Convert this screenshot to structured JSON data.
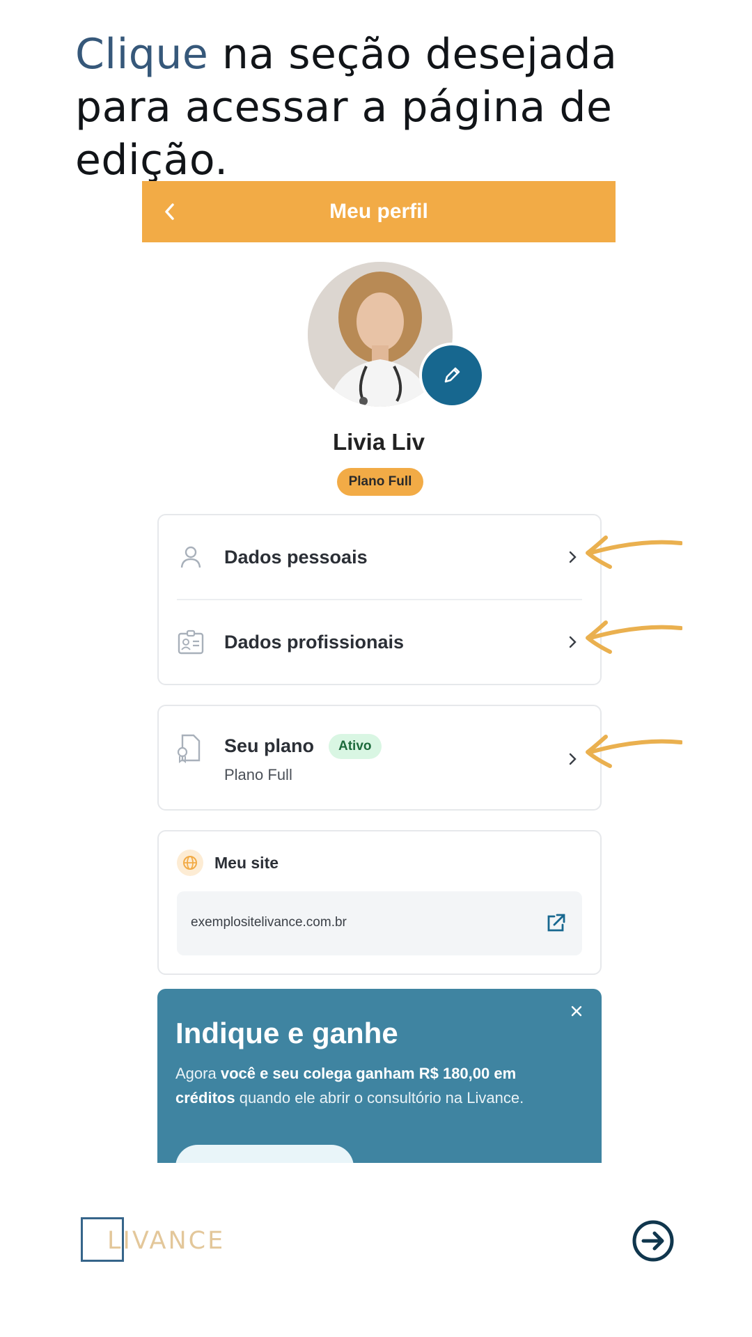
{
  "headline": {
    "accent": "Clique",
    "rest": " na seção desejada para acessar a página de edição."
  },
  "appbar": {
    "title": "Meu perfil",
    "back_icon": "chevron-left-icon"
  },
  "profile": {
    "name": "Livia Liv",
    "plan_badge": "Plano Full",
    "edit_icon": "pencil-icon"
  },
  "sections": [
    {
      "label": "Dados pessoais",
      "icon": "user-icon"
    },
    {
      "label": "Dados profissionais",
      "icon": "id-card-icon"
    }
  ],
  "plan": {
    "label": "Seu plano",
    "status": "Ativo",
    "subtitle": "Plano Full",
    "icon": "document-badge-icon"
  },
  "site": {
    "title": "Meu site",
    "url": "exemplositelivance.com.br",
    "icon": "globe-icon",
    "link_icon": "external-link-icon"
  },
  "promo": {
    "title": "Indique e ganhe",
    "text_prefix": "Agora ",
    "text_bold": "você e seu colega ganham R$ 180,00 em créditos",
    "text_suffix": " quando ele abrir o consultório na Livance.",
    "close_icon": "close-icon"
  },
  "footer": {
    "logo": "LIVANCE",
    "next_icon": "arrow-right-circle-icon"
  },
  "colors": {
    "accent_orange": "#f2ab46",
    "primary_blue": "#17678f",
    "promo_blue": "#3f84a1",
    "headline_accent": "#36587a"
  }
}
